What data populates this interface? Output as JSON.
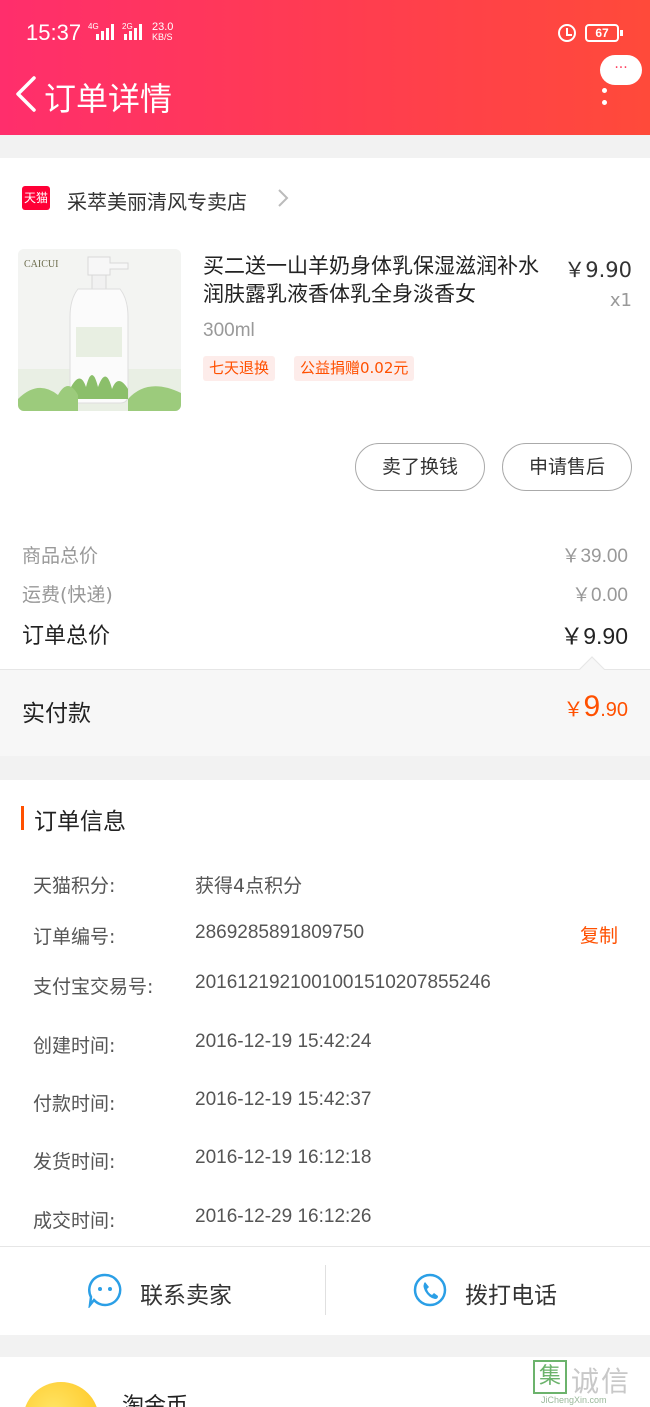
{
  "status_bar": {
    "time": "15:37",
    "sig1": "4G",
    "sig2": "2G",
    "speed_value": "23.0",
    "speed_unit": "KB/S",
    "battery": "67"
  },
  "header": {
    "title": "订单详情",
    "more_bubble": "···"
  },
  "shop": {
    "logo_text": "天猫",
    "name": "采萃美丽清风专卖店"
  },
  "product": {
    "title": "买二送一山羊奶身体乳保湿滋润补水润肤露乳液香体乳全身淡香女",
    "price": "￥9.90",
    "quantity": "x1",
    "sku": "300ml",
    "tags": [
      "七天退换",
      "公益捐赠0.02元"
    ],
    "image_brand": "CAICUI"
  },
  "actions": {
    "sell_label": "卖了换钱",
    "aftersale_label": "申请售后"
  },
  "summary": {
    "goods_label": "商品总价",
    "goods_value": "￥39.00",
    "shipping_label": "运费(快递)",
    "shipping_value": "￥0.00",
    "order_total_label": "订单总价",
    "order_total_value": "￥9.90",
    "paid_label": "实付款",
    "paid_currency": "￥",
    "paid_int": "9",
    "paid_dec": ".90"
  },
  "order_info": {
    "title": "订单信息",
    "copy_label": "复制",
    "rows": [
      {
        "label": "天猫积分:",
        "value": "获得4点积分"
      },
      {
        "label": "订单编号:",
        "value": "2869285891809750"
      },
      {
        "label": "支付宝交易号:",
        "value": "2016121921001001510207855246"
      },
      {
        "label": "创建时间:",
        "value": "2016-12-19 15:42:24"
      },
      {
        "label": "付款时间:",
        "value": "2016-12-19 15:42:37"
      },
      {
        "label": "发货时间:",
        "value": "2016-12-19 16:12:18"
      },
      {
        "label": "成交时间:",
        "value": "2016-12-29 16:12:26"
      }
    ]
  },
  "contact": {
    "seller_label": "联系卖家",
    "phone_label": "拨打电话"
  },
  "coin": {
    "title": "淘金币"
  },
  "watermark": {
    "char": "集",
    "text": "诚信",
    "sub": "JiChengXin.com"
  },
  "colors": {
    "header_start": "#ff2e6c",
    "header_end": "#ff4a3a",
    "accent": "#ff5000",
    "icon_blue": "#2b9fe6"
  }
}
